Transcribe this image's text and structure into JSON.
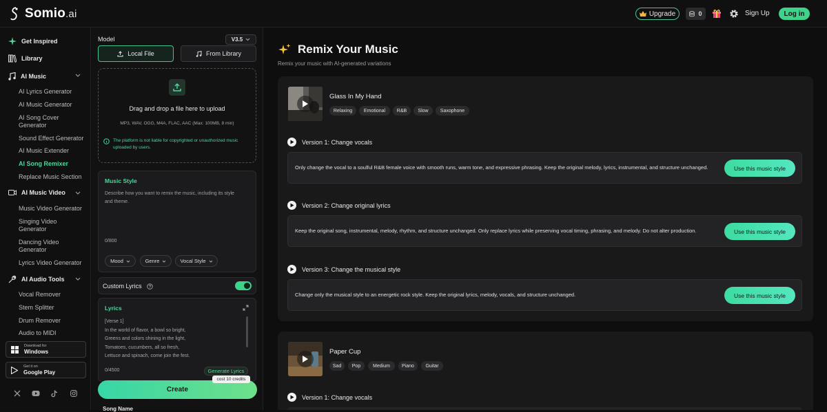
{
  "header": {
    "logo_text": "Somio",
    "logo_suffix": ".ai",
    "upgrade_label": "Upgrade",
    "credits": "0",
    "signup_label": "Sign Up",
    "login_label": "Log in"
  },
  "sidebar": {
    "get_inspired": "Get Inspired",
    "library": "Library",
    "ai_music": {
      "label": "AI Music",
      "items": [
        "AI Lyrics Generator",
        "AI Music Generator",
        "AI Song Cover Generator",
        "Sound Effect Generator",
        "AI Music Extender",
        "AI Song Remixer",
        "Replace Music Section"
      ]
    },
    "ai_music_video": {
      "label": "AI Music Video",
      "items": [
        "Music Video Generator",
        "Singing Video Generator",
        "Dancing Video Generator",
        "Lyrics Video Generator"
      ]
    },
    "ai_audio_tools": {
      "label": "AI Audio Tools",
      "items": [
        "Vocal Remover",
        "Stem Splitter",
        "Drum Remover",
        "Audio to MIDI"
      ]
    },
    "download_windows": {
      "small": "Download for",
      "big": "Windows"
    },
    "download_play": {
      "small": "Get it on",
      "big": "Google Play"
    }
  },
  "panel": {
    "model_label": "Model",
    "model_version": "V3.5",
    "tab_local": "Local File",
    "tab_library": "From Library",
    "upload_title": "Drag and drop a file here to upload",
    "upload_formats": "MP3, WAV, OGG, M4A, FLAC, AAC (Max: 100MB, 8 min)",
    "disclaimer": "The platform is not liable for copyrighted or unauthorized music uploaded by users.",
    "music_style_title": "Music Style",
    "music_style_placeholder": "Describe how you want to remix the music, including its style and theme.",
    "music_style_counter": "0/800",
    "selectors": [
      "Mood",
      "Genre",
      "Vocal Style"
    ],
    "custom_lyrics_label": "Custom Lyrics",
    "lyrics_title": "Lyrics",
    "lyrics_lines": [
      "[Verse 1]",
      "In the world of flavor, a bowl so bright,",
      "Greens and colors shining in the light,",
      "Tomatoes, cucumbers, all so fresh,",
      "Lettuce and spinach, come join the fest."
    ],
    "lyrics_counter": "0/4500",
    "generate_lyrics": "Generate Lyrics",
    "cost_tip": "cost 10 credits",
    "create_label": "Create",
    "song_name_label": "Song Name"
  },
  "main": {
    "title": "Remix Your Music",
    "subtitle": "Remix your music with AI-generated variations",
    "songs": [
      {
        "title": "Glass In My Hand",
        "tags": [
          "Relaxing",
          "Emotional",
          "R&B",
          "Slow",
          "Saxophone"
        ],
        "versions": [
          {
            "label": "Version 1: Change vocals",
            "desc": "Only change the vocal to a soulful R&B female voice with smooth runs, warm tone, and expressive phrasing. Keep the original melody, lyrics, instrumental, and structure unchanged.",
            "button": "Use this music style"
          },
          {
            "label": "Version 2: Change original lyrics",
            "desc": "Keep the original song, instrumental, melody, rhythm, and structure unchanged. Only replace lyrics while preserving vocal timing, phrasing, and melody. Do not alter production.",
            "button": "Use this music style"
          },
          {
            "label": "Version 3: Change the musical style",
            "desc": "Change only the musical style to an energetic rock style. Keep the original lyrics, melody, vocals, and structure unchanged.",
            "button": "Use this music style"
          }
        ]
      },
      {
        "title": "Paper Cup",
        "tags": [
          "Sad",
          "Pop",
          "Medium",
          "Piano",
          "Guitar"
        ],
        "versions": [
          {
            "label": "Version 1: Change vocals"
          }
        ]
      }
    ]
  },
  "colors": {
    "accent": "#3ed28b",
    "background": "#0e0e0f",
    "card": "#19191a"
  }
}
